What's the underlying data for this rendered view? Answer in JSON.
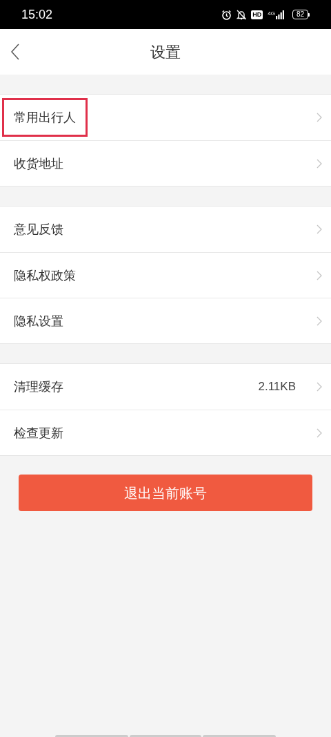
{
  "status_bar": {
    "time": "15:02",
    "hd": "HD",
    "network": "4G",
    "battery": "82"
  },
  "header": {
    "title": "设置"
  },
  "groups": [
    {
      "items": [
        {
          "label": "常用出行人",
          "highlighted": true
        },
        {
          "label": "收货地址",
          "highlighted": false
        }
      ]
    },
    {
      "items": [
        {
          "label": "意见反馈",
          "highlighted": false
        },
        {
          "label": "隐私权政策",
          "highlighted": false
        },
        {
          "label": "隐私设置",
          "highlighted": false
        }
      ]
    },
    {
      "items": [
        {
          "label": "清理缓存",
          "value": "2.11KB",
          "highlighted": false
        },
        {
          "label": "检查更新",
          "highlighted": false
        }
      ]
    }
  ],
  "logout_button": "退出当前账号"
}
